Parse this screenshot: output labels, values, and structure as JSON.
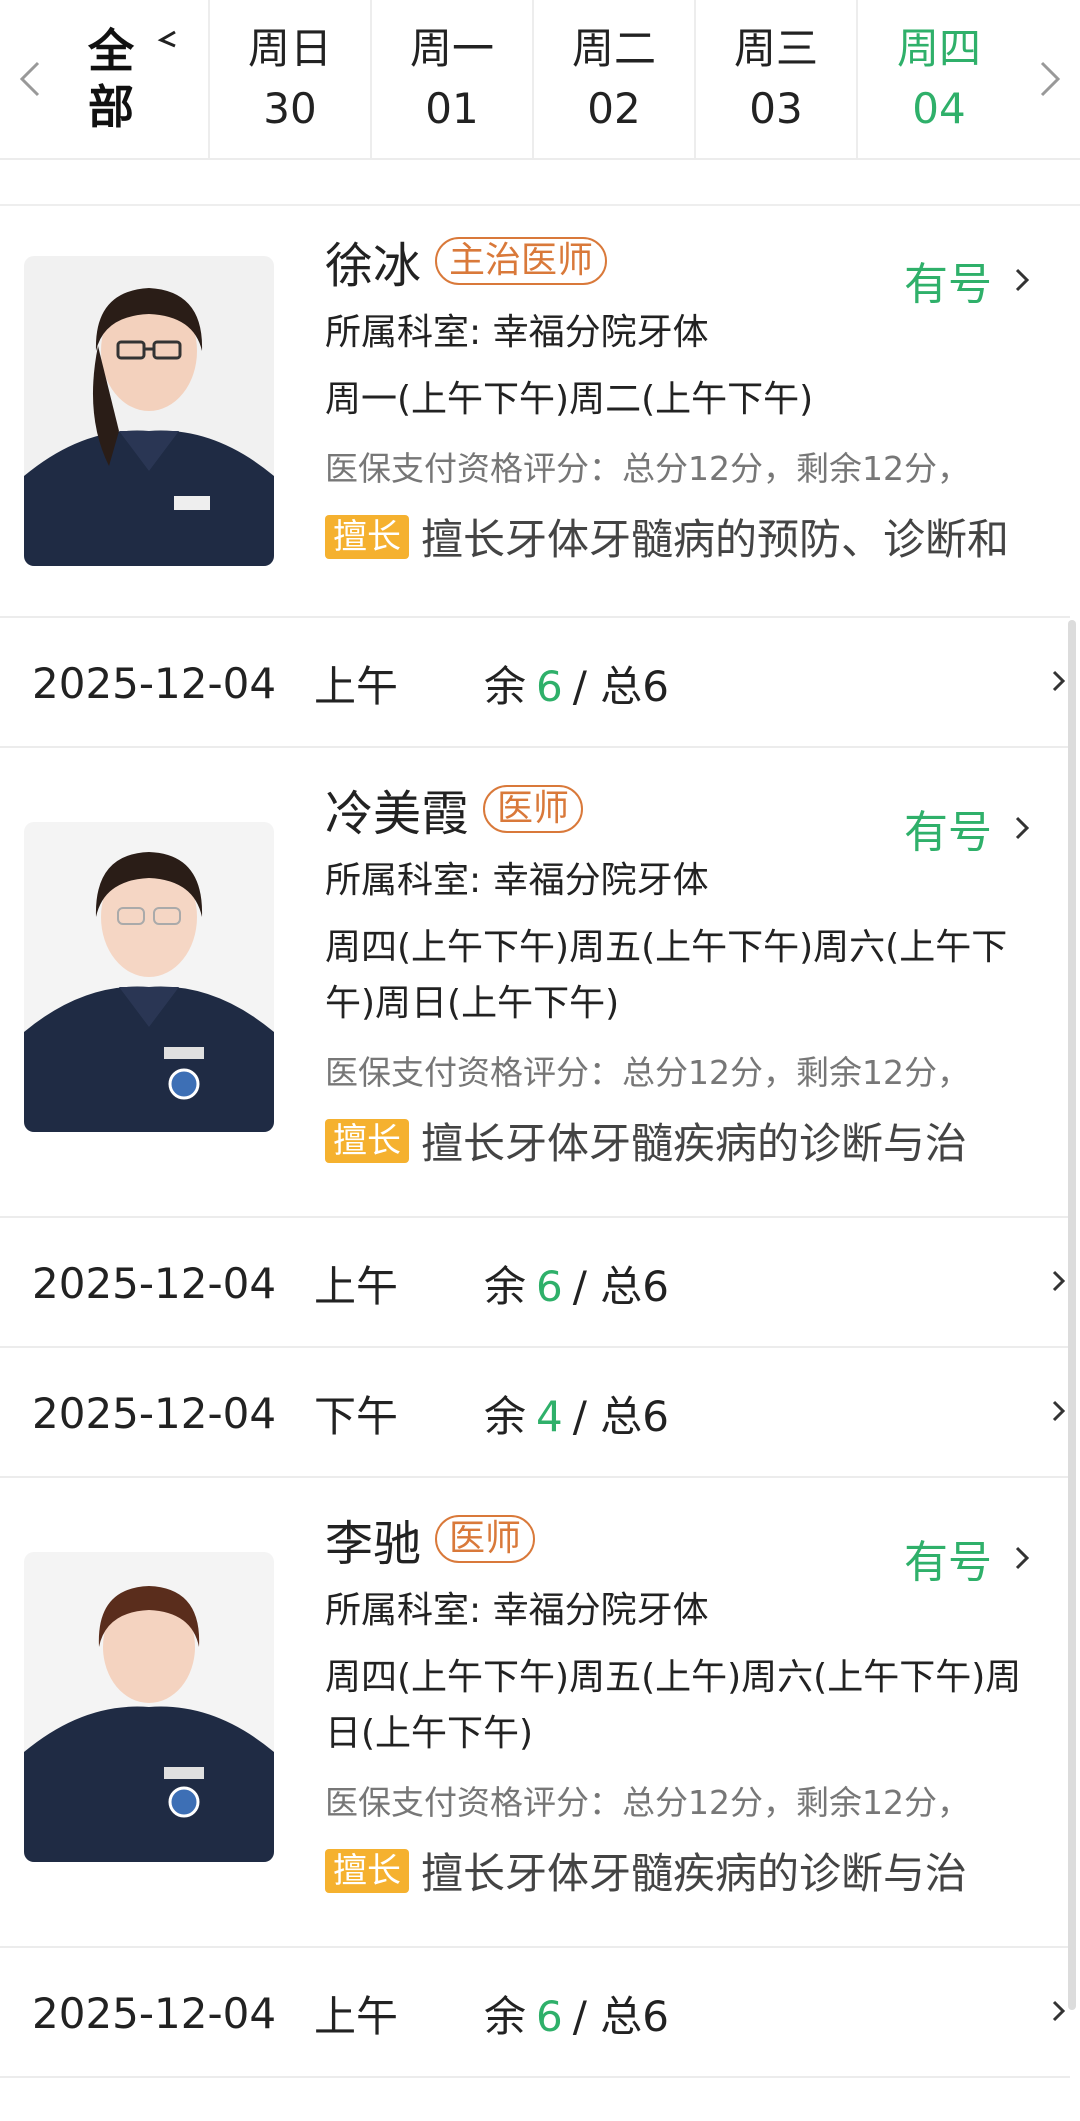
{
  "date_bar": {
    "all_label": "全部",
    "days": [
      {
        "week": "周日",
        "date": "30",
        "active": false
      },
      {
        "week": "周一",
        "date": "01",
        "active": false
      },
      {
        "week": "周二",
        "date": "02",
        "active": false
      },
      {
        "week": "周三",
        "date": "03",
        "active": false
      },
      {
        "week": "周四",
        "date": "04",
        "active": true
      }
    ]
  },
  "accent_color": "#2fb06a",
  "badge_color": "#d9793a",
  "skill_tag_color": "#f5b12f",
  "doctors": [
    {
      "name": "徐冰",
      "title": "主治医师",
      "availability": "有号",
      "department": "所属科室: 幸福分院牙体",
      "schedule": "周一(上午下午)周二(上午下午)",
      "score": "医保支付资格评分：总分12分，剩余12分，",
      "skill_tag": "擅长",
      "skill": "擅长牙体牙髓病的预防、诊断和",
      "slots": [
        {
          "date": "2025-12-04",
          "period": "上午",
          "remaining_prefix": "余",
          "remaining": "6",
          "separator": "/",
          "total": "总6"
        }
      ]
    },
    {
      "name": "冷美霞",
      "title": "医师",
      "availability": "有号",
      "department": "所属科室: 幸福分院牙体",
      "schedule": "周四(上午下午)周五(上午下午)周六(上午下午)周日(上午下午)",
      "score": "医保支付资格评分：总分12分，剩余12分，",
      "skill_tag": "擅长",
      "skill": "擅长牙体牙髓疾病的诊断与治",
      "slots": [
        {
          "date": "2025-12-04",
          "period": "上午",
          "remaining_prefix": "余",
          "remaining": "6",
          "separator": "/",
          "total": "总6"
        },
        {
          "date": "2025-12-04",
          "period": "下午",
          "remaining_prefix": "余",
          "remaining": "4",
          "separator": "/",
          "total": "总6"
        }
      ]
    },
    {
      "name": "李驰",
      "title": "医师",
      "availability": "有号",
      "department": "所属科室: 幸福分院牙体",
      "schedule": "周四(上午下午)周五(上午)周六(上午下午)周日(上午下午)",
      "score": "医保支付资格评分：总分12分，剩余12分，",
      "skill_tag": "擅长",
      "skill": "擅长牙体牙髓疾病的诊断与治",
      "slots": [
        {
          "date": "2025-12-04",
          "period": "上午",
          "remaining_prefix": "余",
          "remaining": "6",
          "separator": "/",
          "total": "总6"
        }
      ]
    }
  ]
}
